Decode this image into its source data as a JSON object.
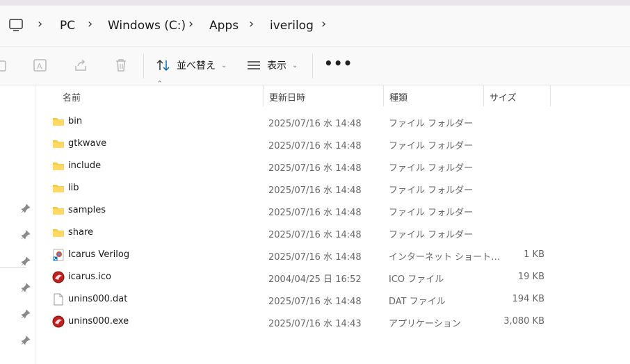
{
  "breadcrumb": [
    "PC",
    "Windows (C:)",
    "Apps",
    "iverilog"
  ],
  "toolbar": {
    "sort_label": "並べ替え",
    "view_label": "表示",
    "more_label": "•••"
  },
  "columns": {
    "name": "名前",
    "date": "更新日時",
    "type": "種類",
    "size": "サイズ"
  },
  "files": [
    {
      "name": "bin",
      "date": "2025/07/16 水 14:48",
      "type": "ファイル フォルダー",
      "size": "",
      "icon": "folder-icon"
    },
    {
      "name": "gtkwave",
      "date": "2025/07/16 水 14:48",
      "type": "ファイル フォルダー",
      "size": "",
      "icon": "folder-icon"
    },
    {
      "name": "include",
      "date": "2025/07/16 水 14:48",
      "type": "ファイル フォルダー",
      "size": "",
      "icon": "folder-icon"
    },
    {
      "name": "lib",
      "date": "2025/07/16 水 14:48",
      "type": "ファイル フォルダー",
      "size": "",
      "icon": "folder-icon"
    },
    {
      "name": "samples",
      "date": "2025/07/16 水 14:48",
      "type": "ファイル フォルダー",
      "size": "",
      "icon": "folder-icon"
    },
    {
      "name": "share",
      "date": "2025/07/16 水 14:48",
      "type": "ファイル フォルダー",
      "size": "",
      "icon": "folder-icon"
    },
    {
      "name": "Icarus Verilog",
      "date": "2025/07/16 水 14:48",
      "type": "インターネット ショート…",
      "size": "1 KB",
      "icon": "shortcut-icon"
    },
    {
      "name": "icarus.ico",
      "date": "2004/04/25 日 16:52",
      "type": "ICO ファイル",
      "size": "19 KB",
      "icon": "icarus-app-icon"
    },
    {
      "name": "unins000.dat",
      "date": "2025/07/16 水 14:48",
      "type": "DAT ファイル",
      "size": "194 KB",
      "icon": "document-icon"
    },
    {
      "name": "unins000.exe",
      "date": "2025/07/16 水 14:43",
      "type": "アプリケーション",
      "size": "3,080 KB",
      "icon": "icarus-app-icon"
    }
  ],
  "colors": {
    "folder": "#f7c948",
    "app_red": "#c21f1f",
    "accent": "#0067c0"
  }
}
